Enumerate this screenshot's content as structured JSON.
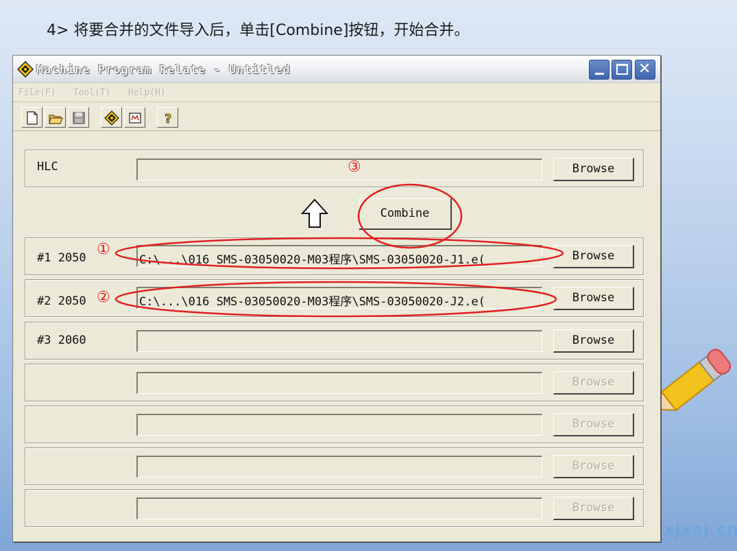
{
  "caption": "4> 将要合并的文件导入后，单击[Combine]按钮，开始合并。",
  "watermark": "xjxsj.cn",
  "window": {
    "title": "Machine Program Relate - Untitled",
    "menu": [
      "File(F)",
      "Tool(T)",
      "Help(H)"
    ]
  },
  "toolbar": {
    "icons": [
      "new-file-icon",
      "open-folder-icon",
      "save-icon",
      "compass-icon",
      "relate-icon",
      "help-icon"
    ]
  },
  "hlc": {
    "label": "HLC",
    "value": "",
    "browse": "Browse"
  },
  "combine_label": "Combine",
  "rows": [
    {
      "label": "#1 2050",
      "value": "C:\\...\\016 SMS-03050020-M03程序\\SMS-03050020-J1.e(",
      "browse": "Browse",
      "enabled": true
    },
    {
      "label": "#2 2050",
      "value": "C:\\...\\016 SMS-03050020-M03程序\\SMS-03050020-J2.e(",
      "browse": "Browse",
      "enabled": true
    },
    {
      "label": "#3 2060",
      "value": "",
      "browse": "Browse",
      "enabled": true
    },
    {
      "label": "",
      "value": "",
      "browse": "Browse",
      "enabled": false
    },
    {
      "label": "",
      "value": "",
      "browse": "Browse",
      "enabled": false
    },
    {
      "label": "",
      "value": "",
      "browse": "Browse",
      "enabled": false
    },
    {
      "label": "",
      "value": "",
      "browse": "Browse",
      "enabled": false
    }
  ],
  "annotations": {
    "step1": "①",
    "step2": "②",
    "step3": "③"
  },
  "colors": {
    "annotation": "#e02020",
    "title_blue": "#3e66b0",
    "window_bg": "#ece9d8"
  }
}
